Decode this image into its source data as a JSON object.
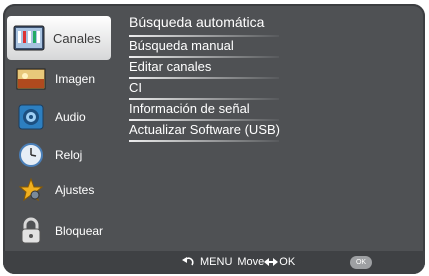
{
  "sidebar": {
    "items": [
      {
        "label": "Canales",
        "icon": "channels-icon"
      },
      {
        "label": "Imagen",
        "icon": "picture-icon"
      },
      {
        "label": "Audio",
        "icon": "speaker-icon"
      },
      {
        "label": "Reloj",
        "icon": "clock-icon"
      },
      {
        "label": "Ajustes",
        "icon": "star-icon"
      },
      {
        "label": "Bloquear",
        "icon": "lock-icon"
      }
    ]
  },
  "menu": {
    "items": [
      "Búsqueda automática",
      "Búsqueda manual",
      "Editar canales",
      "CI",
      "Información de señal",
      "Actualizar Software (USB)"
    ]
  },
  "footer": {
    "menu_label": "MENU",
    "move_label": "Move",
    "ok_label": "OK",
    "ok_button_label": "OK"
  },
  "colors": {
    "background": "#4f5154",
    "highlight": "#ffffff",
    "text": "#ffffff"
  }
}
